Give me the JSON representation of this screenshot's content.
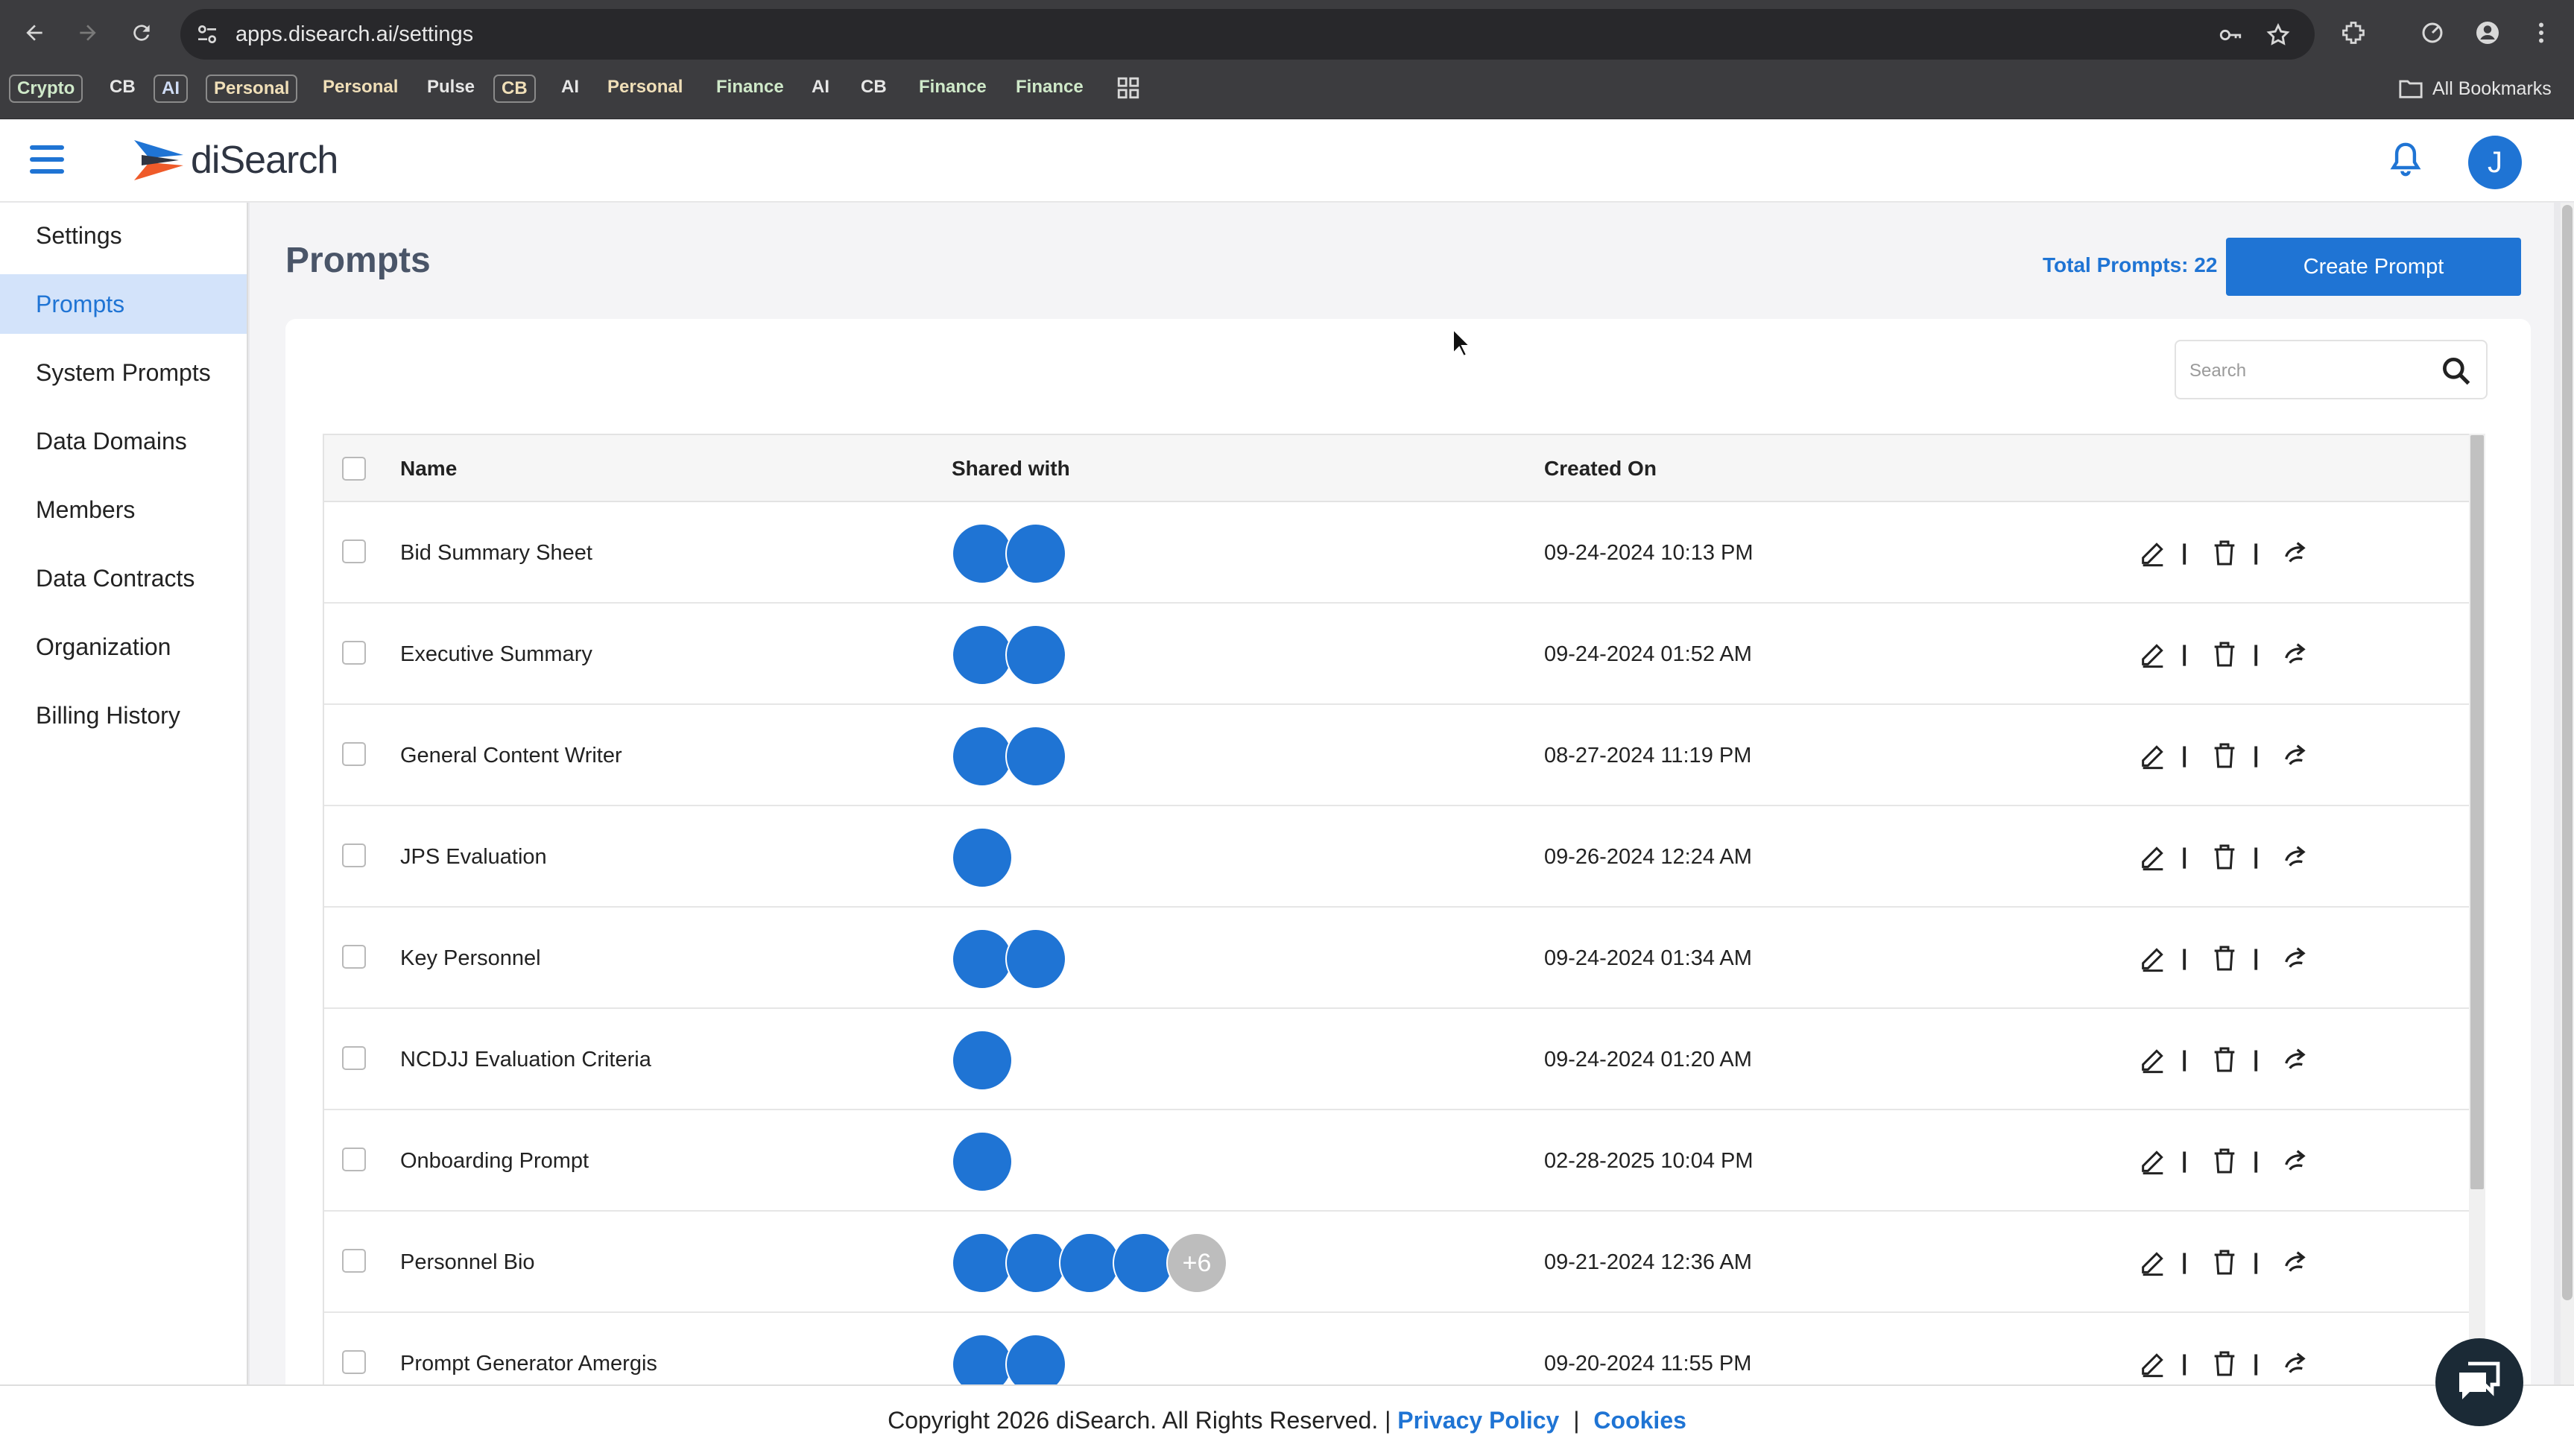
{
  "browser": {
    "url": "apps.disearch.ai/settings",
    "bookmarks": [
      {
        "label": "Crypto",
        "style": "boxed c-green"
      },
      {
        "label": "CB",
        "style": "plain"
      },
      {
        "label": "AI",
        "style": "boxed c-blue"
      },
      {
        "label": "Personal",
        "style": "boxed c-tan"
      },
      {
        "label": "Personal",
        "style": "c-tan"
      },
      {
        "label": "Pulse",
        "style": "plain"
      },
      {
        "label": "CB",
        "style": "boxed c-tan"
      },
      {
        "label": "AI",
        "style": "plain"
      },
      {
        "label": "Personal",
        "style": "c-tan"
      },
      {
        "label": "Finance",
        "style": "c-green"
      },
      {
        "label": "AI",
        "style": "plain"
      },
      {
        "label": "CB",
        "style": "plain"
      },
      {
        "label": "Finance",
        "style": "c-green"
      },
      {
        "label": "Finance",
        "style": "c-green"
      }
    ],
    "all_bookmarks": "All Bookmarks"
  },
  "header": {
    "brand": "diSearch",
    "user_initial": "J"
  },
  "sidebar": {
    "items": [
      {
        "label": "Settings",
        "active": false
      },
      {
        "label": "Prompts",
        "active": true
      },
      {
        "label": "System Prompts",
        "active": false
      },
      {
        "label": "Data Domains",
        "active": false
      },
      {
        "label": "Members",
        "active": false
      },
      {
        "label": "Data Contracts",
        "active": false
      },
      {
        "label": "Organization",
        "active": false
      },
      {
        "label": "Billing History",
        "active": false
      }
    ]
  },
  "main": {
    "title": "Prompts",
    "total_prompts": "Total Prompts: 22",
    "create_button": "Create Prompt",
    "search_placeholder": "Search",
    "columns": {
      "name": "Name",
      "shared_with": "Shared with",
      "created_on": "Created On"
    },
    "rows": [
      {
        "name": "Bid Summary Sheet",
        "shared_count": 2,
        "extra": "",
        "created": "09-24-2024 10:13 PM"
      },
      {
        "name": "Executive Summary",
        "shared_count": 2,
        "extra": "",
        "created": "09-24-2024 01:52 AM"
      },
      {
        "name": "General Content Writer",
        "shared_count": 2,
        "extra": "",
        "created": "08-27-2024 11:19 PM"
      },
      {
        "name": "JPS Evaluation",
        "shared_count": 1,
        "extra": "",
        "created": "09-26-2024 12:24 AM"
      },
      {
        "name": "Key Personnel",
        "shared_count": 2,
        "extra": "",
        "created": "09-24-2024 01:34 AM"
      },
      {
        "name": "NCDJJ Evaluation Criteria",
        "shared_count": 1,
        "extra": "",
        "created": "09-24-2024 01:20 AM"
      },
      {
        "name": "Onboarding Prompt",
        "shared_count": 1,
        "extra": "",
        "created": "02-28-2025 10:04 PM"
      },
      {
        "name": "Personnel Bio",
        "shared_count": 4,
        "extra": "+6",
        "created": "09-21-2024 12:36 AM"
      },
      {
        "name": "Prompt Generator Amergis",
        "shared_count": 2,
        "extra": "",
        "created": "09-20-2024 11:55 PM"
      }
    ],
    "action_separator": "|"
  },
  "footer": {
    "copyright": "Copyright 2026 diSearch. All Rights Reserved. |",
    "privacy": "Privacy Policy",
    "separator": "|",
    "cookies": "Cookies"
  },
  "colors": {
    "accent": "#1f74d4",
    "sidebar_active_bg": "#d3e3fa",
    "chat_button": "#1b2a36"
  },
  "icons": [
    "back-arrow-icon",
    "forward-arrow-icon",
    "reload-icon",
    "site-settings-icon",
    "key-icon",
    "star-icon",
    "extensions-icon",
    "performance-icon",
    "profile-icon",
    "kebab-menu-icon",
    "apps-grid-icon",
    "folder-icon",
    "hamburger-icon",
    "bell-icon",
    "search-icon",
    "edit-icon",
    "trash-icon",
    "share-icon",
    "chat-icon"
  ]
}
